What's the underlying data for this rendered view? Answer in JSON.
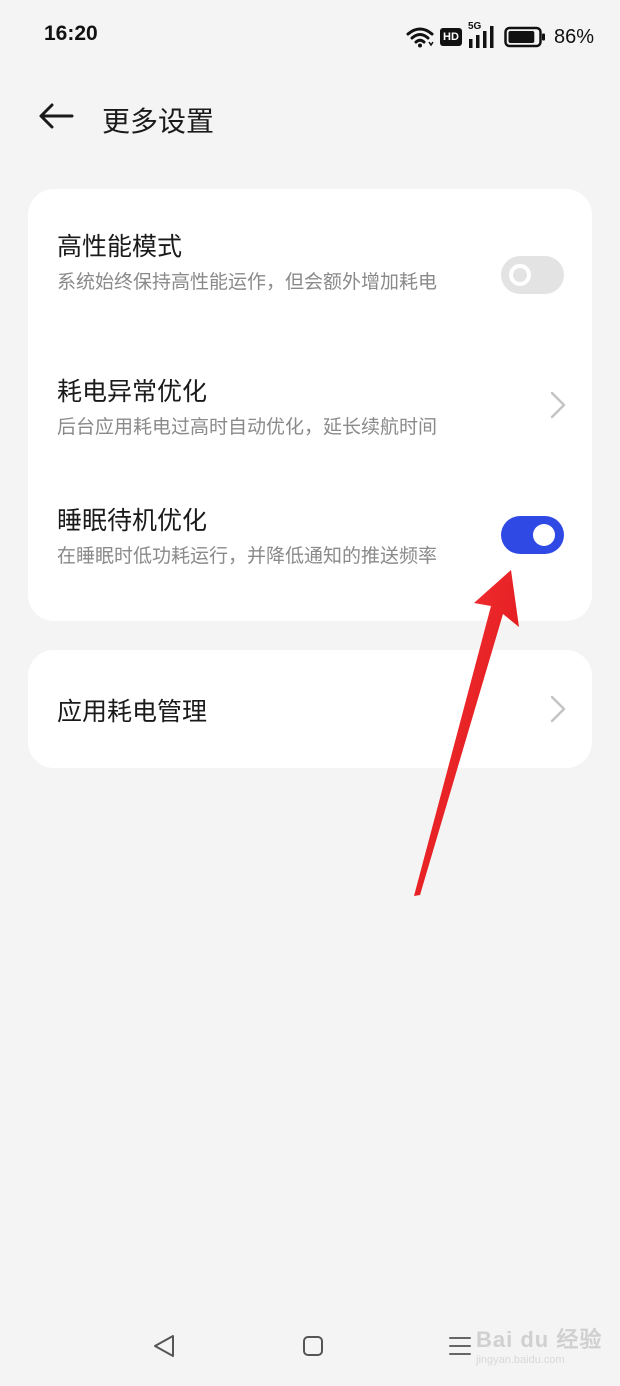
{
  "status_bar": {
    "time": "16:20",
    "hd_label": "HD",
    "network_label": "5G",
    "battery_percent": "86%",
    "battery_level": 0.86
  },
  "header": {
    "title": "更多设置"
  },
  "settings_card": {
    "items": [
      {
        "title": "高性能模式",
        "description": "系统始终保持高性能运作，但会额外增加耗电",
        "control": "toggle",
        "enabled": false
      },
      {
        "title": "耗电异常优化",
        "description": "后台应用耗电过高时自动优化，延长续航时间",
        "control": "chevron"
      },
      {
        "title": "睡眠待机优化",
        "description": "在睡眠时低功耗运行，并降低通知的推送频率",
        "control": "toggle",
        "enabled": true
      }
    ]
  },
  "app_power_card": {
    "title": "应用耗电管理",
    "control": "chevron"
  },
  "colors": {
    "background": "#f4f4f4",
    "card": "#ffffff",
    "toggle_on": "#2f49e4",
    "toggle_off": "#e3e3e3",
    "annotation_arrow": "#e8141b"
  },
  "watermark": {
    "brand": "Bai du 经验",
    "sub": "jingyan.baidu.com"
  }
}
